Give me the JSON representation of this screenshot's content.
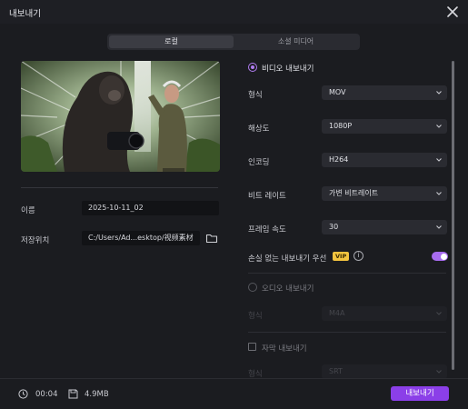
{
  "window": {
    "title": "내보내기"
  },
  "tabs": [
    {
      "label": "로컬",
      "active": true
    },
    {
      "label": "소셜 미디어",
      "active": false
    }
  ],
  "left": {
    "name_label": "이름",
    "name_value": "2025-10-11_02",
    "location_label": "저장위치",
    "location_value": "C:/Users/Ad...esktop/视频素材"
  },
  "right": {
    "video_export_label": "비디오 내보내기",
    "format": {
      "label": "형식",
      "value": "MOV"
    },
    "resolution": {
      "label": "해상도",
      "value": "1080P"
    },
    "encoder": {
      "label": "인코딩",
      "value": "H264"
    },
    "bitrate": {
      "label": "비트 레이트",
      "value": "가변 비트레이트"
    },
    "framerate": {
      "label": "프레임 속도",
      "value": "30"
    },
    "lossless": {
      "label": "손실 없는 내보내기 우선",
      "badge": "VIP",
      "info": "i",
      "enabled": true
    },
    "audio_export_label": "오디오 내보내기",
    "audio_format": {
      "label": "형식",
      "value": "M4A"
    },
    "subtitle_export_label": "자막 내보내기",
    "subtitle_format": {
      "label": "형식",
      "value": "SRT"
    }
  },
  "footer": {
    "duration": "00:04",
    "size": "4.9MB",
    "export_label": "내보내기"
  },
  "colors": {
    "accent": "#8b3fe8",
    "toggle": "#a86cf0",
    "vip": "#f3c43f",
    "background": "#1b1c20"
  },
  "icons": [
    "close-icon",
    "folder-icon",
    "chevron-down-icon",
    "clock-icon",
    "save-icon",
    "info-icon"
  ]
}
